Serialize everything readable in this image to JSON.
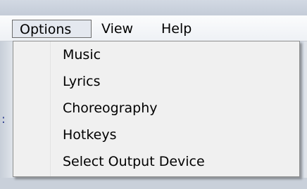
{
  "menubar": {
    "items": [
      {
        "label": "Options",
        "active": true
      },
      {
        "label": "View"
      },
      {
        "label": "Help"
      }
    ]
  },
  "options_menu": {
    "items": [
      {
        "label": "Music"
      },
      {
        "label": "Lyrics"
      },
      {
        "label": "Choreography"
      },
      {
        "label": "Hotkeys"
      },
      {
        "label": "Select Output Device"
      }
    ]
  },
  "background": {
    "left_edge_text": ":"
  }
}
